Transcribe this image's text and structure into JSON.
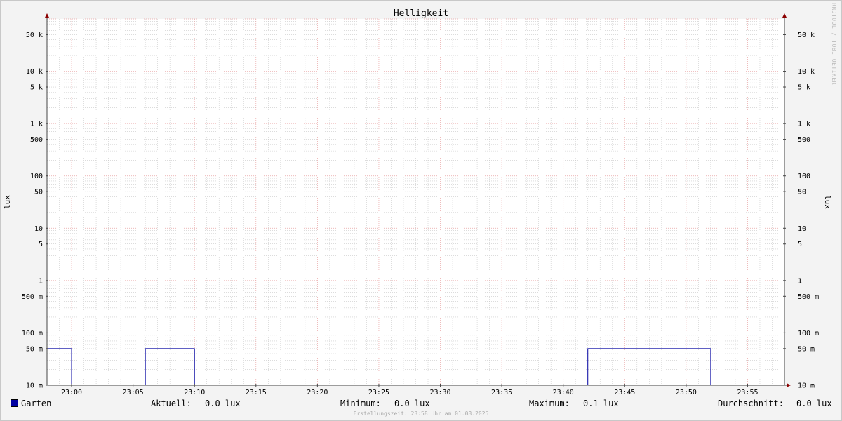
{
  "chart_data": {
    "type": "line",
    "title": "Helligkeit",
    "ylabel": "lux",
    "ylabel_right": "lux",
    "y_scale": "log",
    "ylim": [
      0.01,
      100000
    ],
    "x_range": [
      "22:58",
      "23:58"
    ],
    "x_ticks": [
      "23:00",
      "23:05",
      "23:10",
      "23:15",
      "23:20",
      "23:25",
      "23:30",
      "23:35",
      "23:40",
      "23:45",
      "23:50",
      "23:55"
    ],
    "y_ticks": [
      {
        "value": 50000,
        "label": "50 k"
      },
      {
        "value": 10000,
        "label": "10 k"
      },
      {
        "value": 5000,
        "label": "5 k"
      },
      {
        "value": 1000,
        "label": "1 k"
      },
      {
        "value": 500,
        "label": "500"
      },
      {
        "value": 100,
        "label": "100"
      },
      {
        "value": 50,
        "label": "50"
      },
      {
        "value": 10,
        "label": "10"
      },
      {
        "value": 5,
        "label": "5"
      },
      {
        "value": 1,
        "label": "1"
      },
      {
        "value": 0.5,
        "label": "500 m"
      },
      {
        "value": 0.1,
        "label": "100 m"
      },
      {
        "value": 0.05,
        "label": "50 m"
      },
      {
        "value": 0.01,
        "label": "10 m"
      }
    ],
    "series": [
      {
        "name": "Garten",
        "color": "#0000a0",
        "points": [
          [
            "22:58",
            0.05
          ],
          [
            "23:00",
            0.05
          ],
          [
            "23:00",
            0.01
          ],
          [
            "23:06",
            0.01
          ],
          [
            "23:06",
            0.05
          ],
          [
            "23:10",
            0.05
          ],
          [
            "23:10",
            0.01
          ],
          [
            "23:42",
            0.01
          ],
          [
            "23:42",
            0.05
          ],
          [
            "23:52",
            0.05
          ],
          [
            "23:52",
            0.01
          ],
          [
            "23:58",
            0.01
          ]
        ]
      }
    ],
    "grid": true,
    "grid_major_color": "#e8a0a0",
    "grid_minor_color": "#c8c8c8"
  },
  "legend": {
    "series_name": "Garten",
    "aktuell_label": "Aktuell:",
    "aktuell_value": "0.0 lux",
    "minimum_label": "Minimum:",
    "minimum_value": "0.0 lux",
    "maximum_label": "Maximum:",
    "maximum_value": "0.1 lux",
    "durchschnitt_label": "Durchschnitt:",
    "durchschnitt_value": "0.0 lux"
  },
  "footer": "Erstellungszeit: 23:58 Uhr am 01.08.2025",
  "watermark": "RRDTOOL / TOBI OETIKER"
}
